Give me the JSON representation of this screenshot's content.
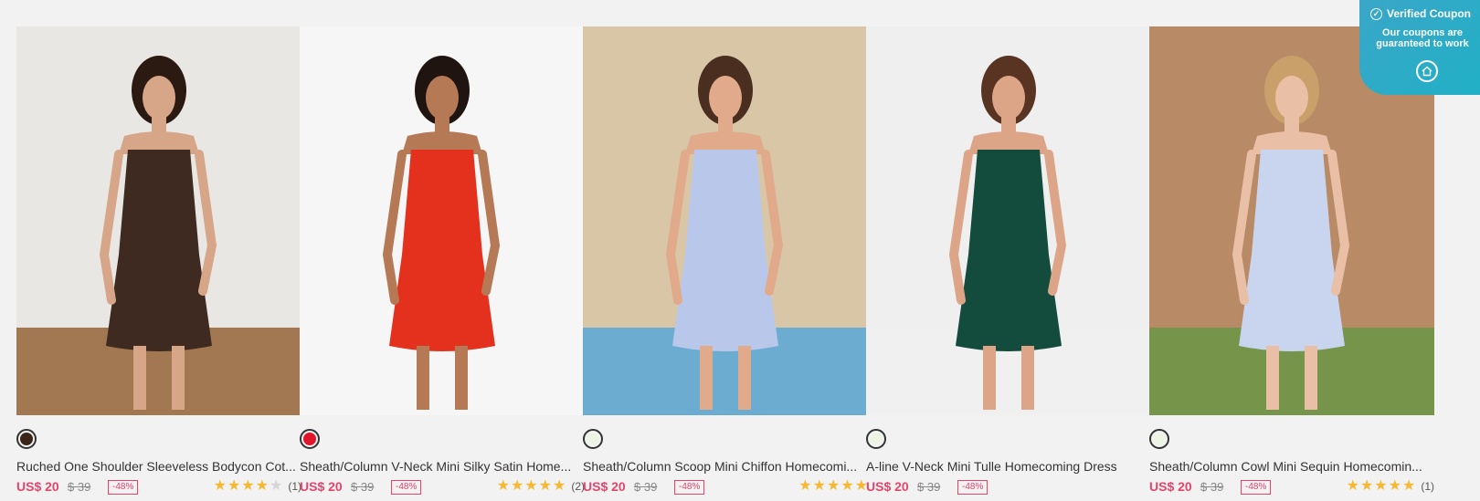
{
  "coupon": {
    "title": "Verified Coupon",
    "line1": "Our coupons are",
    "line2": "guaranteed to work",
    "icon": "check-circle-icon",
    "button_icon": "home-icon"
  },
  "products": [
    {
      "title": "Ruched One Shoulder Sleeveless Bodycon Cot...",
      "price": "US$ 20",
      "original_price": "$ 39",
      "discount": "-48%",
      "rating": 4,
      "reviews": "(1)",
      "swatch_color": "#3b2418",
      "photo": {
        "bg": "#e9e7e4",
        "floor": "#9a6b43",
        "dress": "#3e2a20",
        "skin": "#d7a588",
        "hair": "#2a1a12"
      }
    },
    {
      "title": "Sheath/Column V-Neck Mini Silky Satin Home...",
      "price": "US$ 20",
      "original_price": "$ 39",
      "discount": "-48%",
      "rating": 5,
      "reviews": "(2)",
      "swatch_color": "#e0152a",
      "photo": {
        "bg": "#f6f6f6",
        "floor": "#f6f6f6",
        "dress": "#e3311e",
        "skin": "#b57956",
        "hair": "#1f1410"
      }
    },
    {
      "title": "Sheath/Column Scoop Mini Chiffon Homecomi...",
      "price": "US$ 20",
      "original_price": "$ 39",
      "discount": "-48%",
      "rating": 5,
      "reviews": "",
      "swatch_color": "#eef4e4",
      "photo": {
        "bg": "#d9c6a7",
        "floor": "#5fa9d6",
        "dress": "#b9c8ea",
        "skin": "#e0aa8b",
        "hair": "#4a2e1f"
      }
    },
    {
      "title": "A-line V-Neck Mini Tulle Homecoming Dress",
      "price": "US$ 20",
      "original_price": "$ 39",
      "discount": "-48%",
      "rating": 0,
      "reviews": "",
      "swatch_color": "#eef4e4",
      "photo": {
        "bg": "#efefef",
        "floor": "#efefef",
        "dress": "#134c3c",
        "skin": "#dca588",
        "hair": "#5a3422"
      }
    },
    {
      "title": "Sheath/Column Cowl Mini Sequin Homecomin...",
      "price": "US$ 20",
      "original_price": "$ 39",
      "discount": "-48%",
      "rating": 5,
      "reviews": "(1)",
      "swatch_color": "#eef4e4",
      "photo": {
        "bg": "#b88a66",
        "floor": "#6f9648",
        "dress": "#c9d4ee",
        "skin": "#e9bfa6",
        "hair": "#c9a06a"
      }
    }
  ]
}
